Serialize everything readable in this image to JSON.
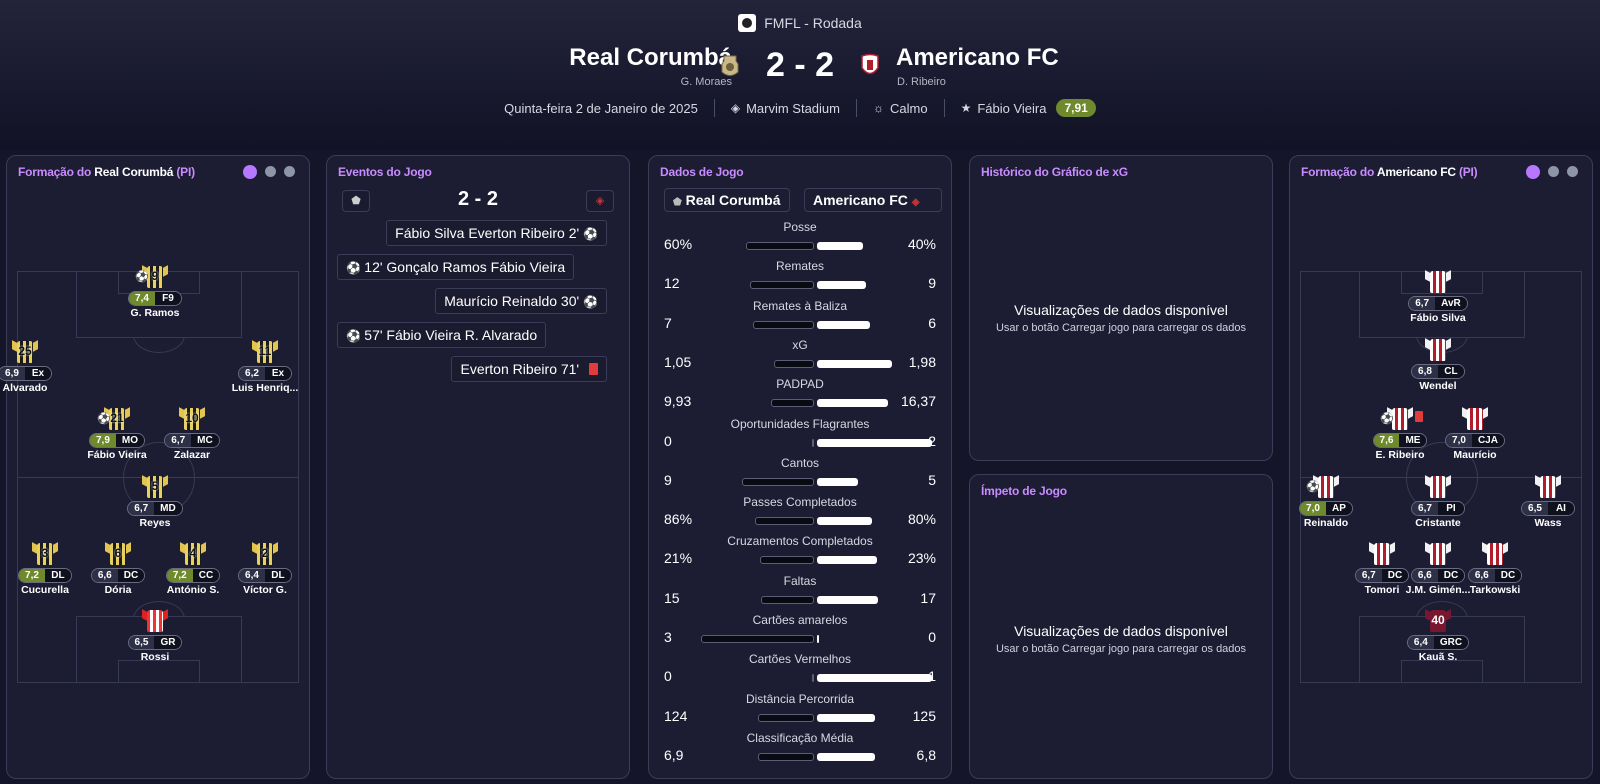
{
  "header": {
    "competition": "FMFL - Rodada",
    "home_team": "Real Corumbá",
    "home_manager": "G. Moraes",
    "away_team": "Americano FC",
    "away_manager": "D. Ribeiro",
    "score": "2 - 2",
    "date": "Quinta-feira 2 de Janeiro de 2025",
    "stadium": "Marvim Stadium",
    "weather": "Calmo",
    "player_of_match": "Fábio Vieira",
    "player_of_match_rating": "7,91"
  },
  "home_formation": {
    "title_prefix": "Formação do",
    "team": "Real Corumbá",
    "tag": "(PI)",
    "players": [
      {
        "num": "9",
        "rating": "7,4",
        "pos": "F9",
        "name": "G. Ramos",
        "good": true,
        "goal": true
      },
      {
        "num": "25",
        "rating": "6,9",
        "pos": "Ex",
        "name": "Alvarado"
      },
      {
        "num": "11",
        "rating": "6,2",
        "pos": "Ex",
        "name": "Luis Henriq..."
      },
      {
        "num": "21",
        "rating": "7,9",
        "pos": "MO",
        "name": "Fábio Vieira",
        "good": true,
        "goal": true
      },
      {
        "num": "10",
        "rating": "6,7",
        "pos": "MC",
        "name": "Zalazar"
      },
      {
        "num": "5",
        "rating": "6,7",
        "pos": "MD",
        "name": "Reyes"
      },
      {
        "num": "3",
        "rating": "7,2",
        "pos": "DL",
        "name": "Cucurella",
        "good": true
      },
      {
        "num": "6",
        "rating": "6,6",
        "pos": "DC",
        "name": "Dória"
      },
      {
        "num": "4",
        "rating": "7,2",
        "pos": "CC",
        "name": "António S.",
        "good": true
      },
      {
        "num": "2",
        "rating": "6,4",
        "pos": "DL",
        "name": "Víctor G."
      },
      {
        "num": "",
        "rating": "6,5",
        "pos": "GR",
        "name": "Rossi"
      }
    ]
  },
  "events": {
    "title": "Eventos do Jogo",
    "score": "2 - 2",
    "items": [
      {
        "text": "Fábio Silva  Everton Ribeiro 2'",
        "side": "away",
        "type": "goal"
      },
      {
        "text": "12'  Gonçalo Ramos  Fábio Vieira",
        "side": "home",
        "type": "goal"
      },
      {
        "text": "Maurício Reinaldo 30'",
        "side": "away",
        "type": "goal"
      },
      {
        "text": "57'  Fábio Vieira  R. Alvarado",
        "side": "home",
        "type": "goal"
      },
      {
        "text": "Everton Ribeiro 71'",
        "side": "away",
        "type": "red_card"
      }
    ]
  },
  "stats": {
    "title": "Dados de Jogo",
    "home_tab": "Real Corumbá",
    "away_tab": "Americano FC",
    "rows": [
      {
        "label": "Posse",
        "home": "60%",
        "away": "40%",
        "hf": 0.6,
        "af": 0.4
      },
      {
        "label": "Remates",
        "home": "12",
        "away": "9",
        "hf": 0.57,
        "af": 0.43
      },
      {
        "label": "Remates à Baliza",
        "home": "7",
        "away": "6",
        "hf": 0.54,
        "af": 0.46
      },
      {
        "label": "xG",
        "home": "1,05",
        "away": "1,98",
        "hf": 0.35,
        "af": 0.65
      },
      {
        "label": "PADPAD",
        "home": "9,93",
        "away": "16,37",
        "hf": 0.38,
        "af": 0.62
      },
      {
        "label": "Oportunidades Flagrantes",
        "home": "0",
        "away": "2",
        "hf": 0.0,
        "af": 1.0
      },
      {
        "label": "Cantos",
        "home": "9",
        "away": "5",
        "hf": 0.64,
        "af": 0.36
      },
      {
        "label": "Passes Completados",
        "home": "86%",
        "away": "80%",
        "hf": 0.52,
        "af": 0.48
      },
      {
        "label": "Cruzamentos Completados",
        "home": "21%",
        "away": "23%",
        "hf": 0.48,
        "af": 0.52
      },
      {
        "label": "Faltas",
        "home": "15",
        "away": "17",
        "hf": 0.47,
        "af": 0.53
      },
      {
        "label": "Cartões amarelos",
        "home": "3",
        "away": "0",
        "hf": 1.0,
        "af": 0.0
      },
      {
        "label": "Cartões Vermelhos",
        "home": "0",
        "away": "1",
        "hf": 0.0,
        "af": 1.0
      },
      {
        "label": "Distância Percorrida",
        "home": "124",
        "away": "125",
        "hf": 0.5,
        "af": 0.5
      },
      {
        "label": "Classificação Média",
        "home": "6,9",
        "away": "6,8",
        "hf": 0.5,
        "af": 0.5
      }
    ]
  },
  "xg_history": {
    "title": "Histórico do Gráfico de xG",
    "message": "Visualizações de dados disponível",
    "hint": "Usar o botão Carregar jogo para carregar os dados"
  },
  "momentum": {
    "title": "Ímpeto de Jogo",
    "message": "Visualizações de dados disponível",
    "hint": "Usar o botão Carregar jogo para carregar os dados"
  },
  "away_formation": {
    "title_prefix": "Formação do",
    "team": "Americano FC",
    "tag": "(PI)",
    "players": [
      {
        "num": "",
        "rating": "6,7",
        "pos": "AvR",
        "name": "Fábio Silva"
      },
      {
        "num": "",
        "rating": "6,8",
        "pos": "CL",
        "name": "Wendel"
      },
      {
        "num": "",
        "rating": "7,6",
        "pos": "ME",
        "name": "E. Ribeiro",
        "good": true,
        "goal": true,
        "red": true
      },
      {
        "num": "",
        "rating": "7,0",
        "pos": "CJA",
        "name": "Maurício"
      },
      {
        "num": "",
        "rating": "7,0",
        "pos": "AP",
        "name": "Reinaldo",
        "good": true,
        "goal": true
      },
      {
        "num": "",
        "rating": "6,7",
        "pos": "PI",
        "name": "Cristante"
      },
      {
        "num": "",
        "rating": "6,5",
        "pos": "AI",
        "name": "Wass"
      },
      {
        "num": "",
        "rating": "6,7",
        "pos": "DC",
        "name": "Tomori"
      },
      {
        "num": "",
        "rating": "6,6",
        "pos": "DC",
        "name": "J.M. Gimén..."
      },
      {
        "num": "",
        "rating": "6,6",
        "pos": "DC",
        "name": "Tarkowski"
      },
      {
        "num": "40",
        "rating": "6,4",
        "pos": "GRC",
        "name": "Kauã S."
      }
    ]
  },
  "colors": {
    "accent": "#c98cff",
    "good_rating": "#6f8a2c",
    "red_card": "#e23b3b"
  }
}
